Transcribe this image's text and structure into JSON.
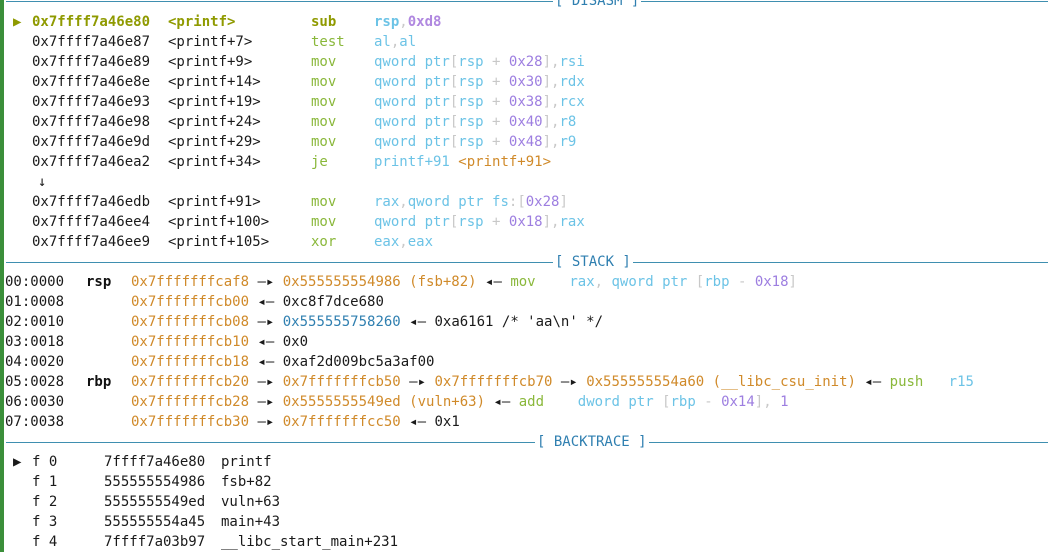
{
  "colors": {
    "background": "#ffffff",
    "current_line": "#8f9a00",
    "mnemonic": "#8ab83b",
    "operand": "#6cc3e6",
    "immediate": "#9d7ee0",
    "stack_address": "#d08a2a",
    "code_address": "#d08a2a",
    "heap_address": "#2f7fb0",
    "section_header": "#2f7fb0",
    "left_border": "#3b8f3a"
  },
  "icons": {
    "current_marker": "▶",
    "jump_arrow": "↓",
    "deref_arrow": "—▸",
    "symbol_arrow": "◂—"
  },
  "disasm": {
    "header": "[ DISASM ]",
    "jump_arrow_label": "↓",
    "lines": [
      {
        "marker": "▶",
        "addr": "0x7ffff7a46e80",
        "sym": "<printf>",
        "mnem": "sub",
        "operands": [
          {
            "t": "rsp",
            "k": "op"
          },
          {
            "t": ",",
            "k": "sep"
          },
          {
            "t": "0xd8",
            "k": "num"
          }
        ]
      },
      {
        "marker": "",
        "addr": "0x7ffff7a46e87",
        "sym": "<printf+7>",
        "mnem": "test",
        "operands": [
          {
            "t": "al",
            "k": "op"
          },
          {
            "t": ",",
            "k": "sep"
          },
          {
            "t": "al",
            "k": "op"
          }
        ]
      },
      {
        "marker": "",
        "addr": "0x7ffff7a46e89",
        "sym": "<printf+9>",
        "mnem": "mov",
        "operands": [
          {
            "t": "qword ptr",
            "k": "op"
          },
          {
            "t": "[",
            "k": "sep"
          },
          {
            "t": "rsp",
            "k": "op"
          },
          {
            "t": " + ",
            "k": "sep"
          },
          {
            "t": "0x28",
            "k": "num"
          },
          {
            "t": "],",
            "k": "sep"
          },
          {
            "t": "rsi",
            "k": "op"
          }
        ]
      },
      {
        "marker": "",
        "addr": "0x7ffff7a46e8e",
        "sym": "<printf+14>",
        "mnem": "mov",
        "operands": [
          {
            "t": "qword ptr",
            "k": "op"
          },
          {
            "t": "[",
            "k": "sep"
          },
          {
            "t": "rsp",
            "k": "op"
          },
          {
            "t": " + ",
            "k": "sep"
          },
          {
            "t": "0x30",
            "k": "num"
          },
          {
            "t": "],",
            "k": "sep"
          },
          {
            "t": "rdx",
            "k": "op"
          }
        ]
      },
      {
        "marker": "",
        "addr": "0x7ffff7a46e93",
        "sym": "<printf+19>",
        "mnem": "mov",
        "operands": [
          {
            "t": "qword ptr",
            "k": "op"
          },
          {
            "t": "[",
            "k": "sep"
          },
          {
            "t": "rsp",
            "k": "op"
          },
          {
            "t": " + ",
            "k": "sep"
          },
          {
            "t": "0x38",
            "k": "num"
          },
          {
            "t": "],",
            "k": "sep"
          },
          {
            "t": "rcx",
            "k": "op"
          }
        ]
      },
      {
        "marker": "",
        "addr": "0x7ffff7a46e98",
        "sym": "<printf+24>",
        "mnem": "mov",
        "operands": [
          {
            "t": "qword ptr",
            "k": "op"
          },
          {
            "t": "[",
            "k": "sep"
          },
          {
            "t": "rsp",
            "k": "op"
          },
          {
            "t": " + ",
            "k": "sep"
          },
          {
            "t": "0x40",
            "k": "num"
          },
          {
            "t": "],",
            "k": "sep"
          },
          {
            "t": "r8",
            "k": "op"
          }
        ]
      },
      {
        "marker": "",
        "addr": "0x7ffff7a46e9d",
        "sym": "<printf+29>",
        "mnem": "mov",
        "operands": [
          {
            "t": "qword ptr",
            "k": "op"
          },
          {
            "t": "[",
            "k": "sep"
          },
          {
            "t": "rsp",
            "k": "op"
          },
          {
            "t": " + ",
            "k": "sep"
          },
          {
            "t": "0x48",
            "k": "num"
          },
          {
            "t": "],",
            "k": "sep"
          },
          {
            "t": "r9",
            "k": "op"
          }
        ]
      },
      {
        "marker": "",
        "addr": "0x7ffff7a46ea2",
        "sym": "<printf+34>",
        "mnem": "je",
        "operands": [
          {
            "t": "printf+91",
            "k": "op"
          },
          {
            "t": " ",
            "k": "sep"
          },
          {
            "t": "<printf+91>",
            "k": "code"
          }
        ],
        "jump": true
      },
      {
        "marker": "",
        "addr": "0x7ffff7a46edb",
        "sym": "<printf+91>",
        "mnem": "mov",
        "operands": [
          {
            "t": "rax",
            "k": "op"
          },
          {
            "t": ",",
            "k": "sep"
          },
          {
            "t": "qword ptr",
            "k": "op"
          },
          {
            "t": " ",
            "k": "sep"
          },
          {
            "t": "fs",
            "k": "op"
          },
          {
            "t": ":[",
            "k": "sep"
          },
          {
            "t": "0x28",
            "k": "num"
          },
          {
            "t": "]",
            "k": "sep"
          }
        ]
      },
      {
        "marker": "",
        "addr": "0x7ffff7a46ee4",
        "sym": "<printf+100>",
        "mnem": "mov",
        "operands": [
          {
            "t": "qword ptr",
            "k": "op"
          },
          {
            "t": "[",
            "k": "sep"
          },
          {
            "t": "rsp",
            "k": "op"
          },
          {
            "t": " + ",
            "k": "sep"
          },
          {
            "t": "0x18",
            "k": "num"
          },
          {
            "t": "],",
            "k": "sep"
          },
          {
            "t": "rax",
            "k": "op"
          }
        ]
      },
      {
        "marker": "",
        "addr": "0x7ffff7a46ee9",
        "sym": "<printf+105>",
        "mnem": "xor",
        "operands": [
          {
            "t": "eax",
            "k": "op"
          },
          {
            "t": ",",
            "k": "sep"
          },
          {
            "t": "eax",
            "k": "op"
          }
        ]
      }
    ]
  },
  "stack": {
    "header": "[ STACK ]",
    "lines": [
      {
        "idx": "00:0000",
        "reg": "rsp",
        "parts": [
          {
            "t": "0x7fffffffcaf8",
            "k": "stack"
          },
          {
            "t": " —▸ ",
            "k": "arrow"
          },
          {
            "t": "0x555555554986 (fsb+82)",
            "k": "code"
          },
          {
            "t": " ◂— ",
            "k": "arrow"
          },
          {
            "t": "mov",
            "k": "mn"
          },
          {
            "t": "    ",
            "k": "sep"
          },
          {
            "t": "rax",
            "k": "op"
          },
          {
            "t": ", ",
            "k": "sep"
          },
          {
            "t": "qword ptr",
            "k": "op"
          },
          {
            "t": " [",
            "k": "sep"
          },
          {
            "t": "rbp",
            "k": "op"
          },
          {
            "t": " - ",
            "k": "sep"
          },
          {
            "t": "0x18",
            "k": "num"
          },
          {
            "t": "]",
            "k": "sep"
          }
        ]
      },
      {
        "idx": "01:0008",
        "reg": "",
        "parts": [
          {
            "t": "0x7fffffffcb00",
            "k": "stack"
          },
          {
            "t": " ◂— ",
            "k": "arrow"
          },
          {
            "t": "0xc8f7dce680",
            "k": "data"
          }
        ]
      },
      {
        "idx": "02:0010",
        "reg": "",
        "parts": [
          {
            "t": "0x7fffffffcb08",
            "k": "stack"
          },
          {
            "t": " —▸ ",
            "k": "arrow"
          },
          {
            "t": "0x555555758260",
            "k": "heap"
          },
          {
            "t": " ◂— ",
            "k": "arrow"
          },
          {
            "t": "0xa6161 /* 'aa\\n' */",
            "k": "data"
          }
        ]
      },
      {
        "idx": "03:0018",
        "reg": "",
        "parts": [
          {
            "t": "0x7fffffffcb10",
            "k": "stack"
          },
          {
            "t": " ◂— ",
            "k": "arrow"
          },
          {
            "t": "0x0",
            "k": "data"
          }
        ]
      },
      {
        "idx": "04:0020",
        "reg": "",
        "parts": [
          {
            "t": "0x7fffffffcb18",
            "k": "stack"
          },
          {
            "t": " ◂— ",
            "k": "arrow"
          },
          {
            "t": "0xaf2d009bc5a3af00",
            "k": "data"
          }
        ]
      },
      {
        "idx": "05:0028",
        "reg": "rbp",
        "parts": [
          {
            "t": "0x7fffffffcb20",
            "k": "stack"
          },
          {
            "t": " —▸ ",
            "k": "arrow"
          },
          {
            "t": "0x7fffffffcb50",
            "k": "stack"
          },
          {
            "t": " —▸ ",
            "k": "arrow"
          },
          {
            "t": "0x7fffffffcb70",
            "k": "stack"
          },
          {
            "t": " —▸ ",
            "k": "arrow"
          },
          {
            "t": "0x555555554a60 (__libc_csu_init)",
            "k": "code"
          },
          {
            "t": " ◂— ",
            "k": "arrow"
          },
          {
            "t": "push",
            "k": "mn"
          },
          {
            "t": "   ",
            "k": "sep"
          },
          {
            "t": "r15",
            "k": "op"
          }
        ]
      },
      {
        "idx": "06:0030",
        "reg": "",
        "parts": [
          {
            "t": "0x7fffffffcb28",
            "k": "stack"
          },
          {
            "t": " —▸ ",
            "k": "arrow"
          },
          {
            "t": "0x5555555549ed (vuln+63)",
            "k": "code"
          },
          {
            "t": " ◂— ",
            "k": "arrow"
          },
          {
            "t": "add",
            "k": "mn"
          },
          {
            "t": "    ",
            "k": "sep"
          },
          {
            "t": "dword ptr",
            "k": "op"
          },
          {
            "t": " [",
            "k": "sep"
          },
          {
            "t": "rbp",
            "k": "op"
          },
          {
            "t": " - ",
            "k": "sep"
          },
          {
            "t": "0x14",
            "k": "num"
          },
          {
            "t": "], ",
            "k": "sep"
          },
          {
            "t": "1",
            "k": "num"
          }
        ]
      },
      {
        "idx": "07:0038",
        "reg": "",
        "parts": [
          {
            "t": "0x7fffffffcb30",
            "k": "stack"
          },
          {
            "t": " —▸ ",
            "k": "arrow"
          },
          {
            "t": "0x7fffffffcc50",
            "k": "stack"
          },
          {
            "t": " ◂— ",
            "k": "arrow"
          },
          {
            "t": "0x1",
            "k": "data"
          }
        ]
      }
    ]
  },
  "backtrace": {
    "header": "[ BACKTRACE ]",
    "frames": [
      {
        "marker": "▶",
        "frame": "f 0",
        "addr": "7ffff7a46e80",
        "sym": "printf"
      },
      {
        "marker": "",
        "frame": "f 1",
        "addr": "555555554986",
        "sym": "fsb+82"
      },
      {
        "marker": "",
        "frame": "f 2",
        "addr": "5555555549ed",
        "sym": "vuln+63"
      },
      {
        "marker": "",
        "frame": "f 3",
        "addr": "555555554a45",
        "sym": "main+43"
      },
      {
        "marker": "",
        "frame": "f 4",
        "addr": "7ffff7a03b97",
        "sym": "__libc_start_main+231"
      }
    ]
  }
}
